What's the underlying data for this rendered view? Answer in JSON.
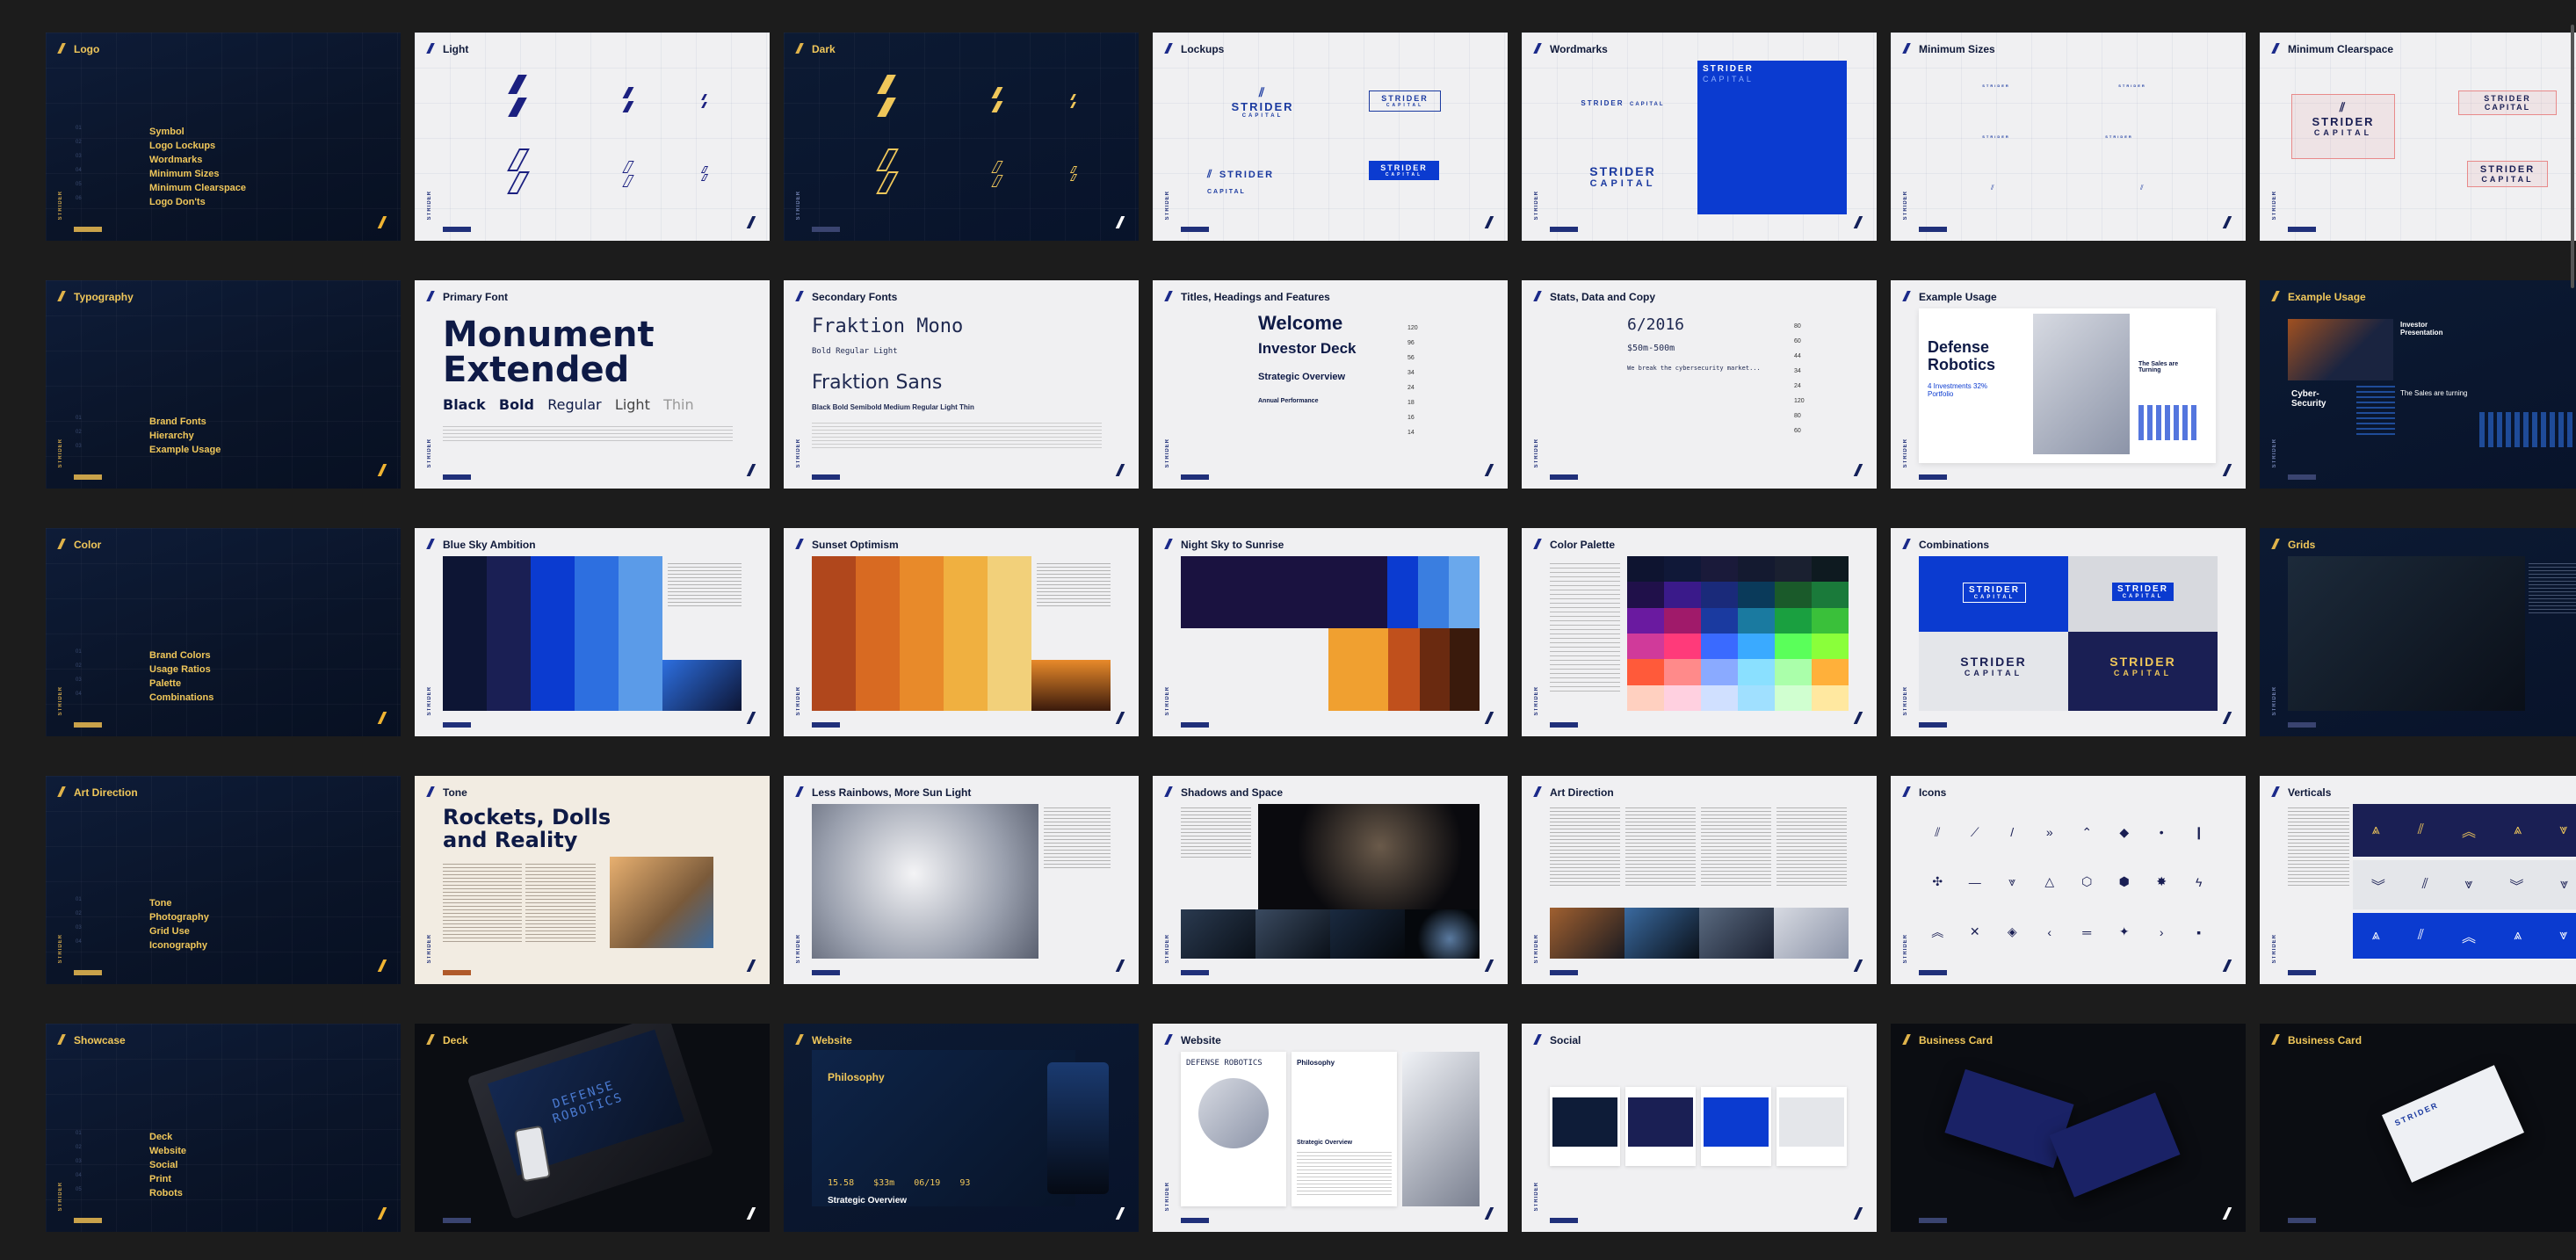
{
  "brand": {
    "name": "STRIDER",
    "sub": "CAPITAL"
  },
  "colors": {
    "gold": "#f0c75a",
    "navy": "#0e1c38",
    "blue": "#0b3bd0",
    "page_bg": "#1c1c1c"
  },
  "rows": [
    {
      "slides": [
        {
          "title": "Logo",
          "menu": [
            "Symbol",
            "Logo Lockups",
            "Wordmarks",
            "Minimum Sizes",
            "Minimum Clearspace",
            "Logo Don'ts"
          ]
        },
        {
          "title": "Light"
        },
        {
          "title": "Dark"
        },
        {
          "title": "Lockups"
        },
        {
          "title": "Wordmarks"
        },
        {
          "title": "Minimum Sizes"
        },
        {
          "title": "Minimum Clearspace"
        }
      ]
    },
    {
      "slides": [
        {
          "title": "Typography",
          "menu": [
            "Brand Fonts",
            "Hierarchy",
            "Example Usage"
          ]
        },
        {
          "title": "Primary Font",
          "headline": "Monument Extended",
          "weights": [
            "Black",
            "Bold",
            "Regular",
            "Light",
            "Thin"
          ]
        },
        {
          "title": "Secondary Fonts",
          "font1": "Fraktion Mono",
          "font1_weights": "Bold  Regular  Light",
          "font2": "Fraktion Sans",
          "font2_weights": "Black  Bold  Semibold  Medium  Regular  Light  Thin"
        },
        {
          "title": "Titles, Headings and Features",
          "h1": "Welcome",
          "h2": "Investor Deck",
          "h3": "Strategic Overview",
          "h4": "Annual Performance",
          "sizes": [
            "120",
            "96",
            "56",
            "34",
            "24",
            "18",
            "16",
            "14"
          ]
        },
        {
          "title": "Stats, Data and Copy",
          "s1": "6/2016",
          "s2": "$50m-500m",
          "s3": "We break the cybersecurity market...",
          "sizes": [
            "80",
            "60",
            "44",
            "34",
            "24",
            "120",
            "80",
            "60"
          ]
        },
        {
          "title": "Example Usage",
          "headline": "Defense Robotics",
          "stat": "4 Investments 32% Portfolio",
          "aside": "The Sales are Turning"
        },
        {
          "title": "Example Usage",
          "headline": "Cyber-Security",
          "aside": "The Sales are turning",
          "label": "Investor Presentation"
        }
      ]
    },
    {
      "slides": [
        {
          "title": "Color",
          "menu": [
            "Brand Colors",
            "Usage Ratios",
            "Palette",
            "Combinations"
          ]
        },
        {
          "title": "Blue Sky Ambition",
          "swatches": [
            "#0d1534",
            "#1a1f54",
            "#0b3bd0",
            "#2d6fe0",
            "#5b9be8"
          ]
        },
        {
          "title": "Sunset Optimism",
          "swatches": [
            "#b0471c",
            "#d86a22",
            "#e88a2a",
            "#f0b040",
            "#f2d07a"
          ]
        },
        {
          "title": "Night Sky to Sunrise",
          "top": [
            "#1a1240",
            "#1a1240",
            "#1a1240",
            "#0b3bd0",
            "#3a7ee0",
            "#6aa8ec"
          ],
          "bottom": [
            "#f0a030",
            "#c0501c",
            "#6a2a10",
            "#3a1a0c"
          ]
        },
        {
          "title": "Color Palette",
          "swatches": [
            "#0e1430",
            "#3a1a8a",
            "#1a7a3a",
            "#7a1aa0",
            "#a01a6a",
            "#1aa040",
            "#ff3a7a",
            "#3a8aff",
            "#5aff5a",
            "#ffb03a",
            "#ffd0e0",
            "#a0e0ff"
          ]
        },
        {
          "title": "Combinations",
          "brand_a": "STRIDER",
          "brand_b": "CAPITAL"
        },
        {
          "title": "Grids"
        }
      ]
    },
    {
      "slides": [
        {
          "title": "Art Direction",
          "menu": [
            "Tone",
            "Photography",
            "Grid Use",
            "Iconography"
          ]
        },
        {
          "title": "Tone",
          "headline": "Rockets, Dolls and Reality"
        },
        {
          "title": "Less Rainbows, More Sun Light"
        },
        {
          "title": "Shadows and Space"
        },
        {
          "title": "Art Direction"
        },
        {
          "title": "Icons"
        },
        {
          "title": "Verticals"
        }
      ]
    },
    {
      "slides": [
        {
          "title": "Showcase",
          "menu": [
            "Deck",
            "Website",
            "Social",
            "Print",
            "Robots"
          ]
        },
        {
          "title": "Deck",
          "screen_text": "DEFENSE ROBOTICS"
        },
        {
          "title": "Website",
          "heading": "Philosophy",
          "stats": [
            "15.58",
            "$33m",
            "06/19",
            "93"
          ],
          "footer_text": "Strategic Overview"
        },
        {
          "title": "Website",
          "left_text": "DEFENSE ROBOTICS",
          "heading": "Philosophy",
          "sub": "Strategic Overview"
        },
        {
          "title": "Social"
        },
        {
          "title": "Business Card"
        },
        {
          "title": "Business Card"
        }
      ]
    }
  ]
}
